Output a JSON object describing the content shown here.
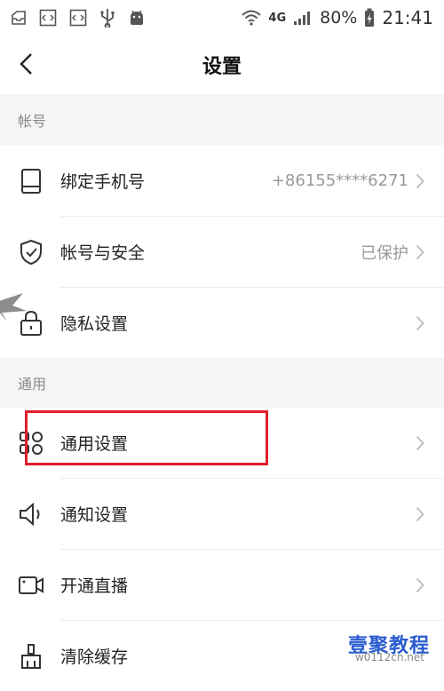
{
  "status_bar": {
    "network": "4G",
    "battery": "80%",
    "time": "21:41"
  },
  "nav": {
    "title": "设置"
  },
  "sections": [
    {
      "header": "帐号",
      "rows": [
        {
          "label": "绑定手机号",
          "value": "+86155****6271",
          "icon": "phone-icon"
        },
        {
          "label": "帐号与安全",
          "value": "已保护",
          "icon": "shield-icon"
        },
        {
          "label": "隐私设置",
          "value": "",
          "icon": "lock-icon"
        }
      ]
    },
    {
      "header": "通用",
      "rows": [
        {
          "label": "通用设置",
          "value": "",
          "icon": "grid-icon"
        },
        {
          "label": "通知设置",
          "value": "",
          "icon": "speaker-icon"
        },
        {
          "label": "开通直播",
          "value": "",
          "icon": "video-icon"
        },
        {
          "label": "清除缓存",
          "value": "",
          "icon": "brush-icon"
        }
      ]
    }
  ],
  "watermark": {
    "text": "壹聚教程",
    "sub": "w0112cn.net"
  }
}
